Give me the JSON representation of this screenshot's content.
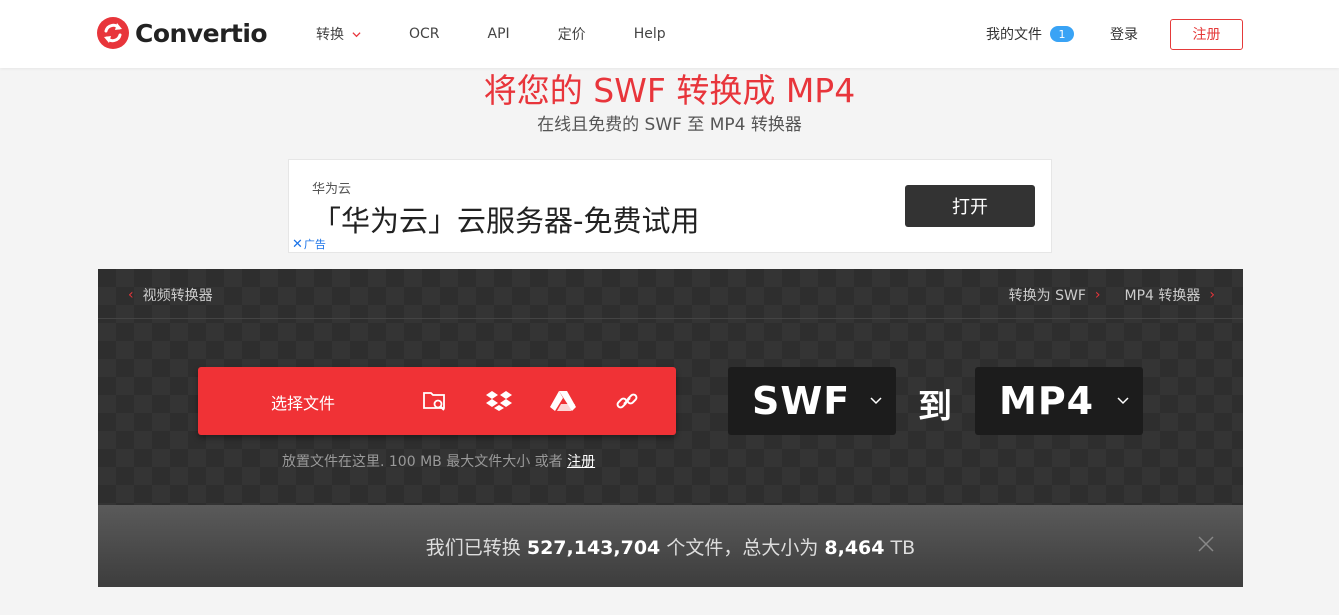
{
  "brand": {
    "name": "Convertio",
    "color": "#e8353b"
  },
  "nav": {
    "items": [
      {
        "label": "转换",
        "has_dropdown": true
      },
      {
        "label": "OCR"
      },
      {
        "label": "API"
      },
      {
        "label": "定价"
      },
      {
        "label": "Help"
      }
    ],
    "my_files": "我的文件",
    "file_count": "1",
    "login": "登录",
    "signup": "注册"
  },
  "hero": {
    "title": "将您的 SWF 转换成 MP4",
    "subtitle": "在线且免费的 SWF 至 MP4 转换器"
  },
  "ad": {
    "brand": "华为云",
    "headline": "「华为云」云服务器-免费试用",
    "cta": "打开",
    "ad_mark": "✕",
    "ad_label": "广告"
  },
  "converter": {
    "crumb_left": "视频转换器",
    "crumb_right": [
      "转换为 SWF",
      "MP4 转换器"
    ],
    "choose_label": "选择文件",
    "source_icons": [
      "folder-search-icon",
      "dropbox-icon",
      "google-drive-icon",
      "link-icon"
    ],
    "drop_hint": "放置文件在这里. 100 MB 最大文件大小 或者",
    "drop_hint_link": "注册",
    "from_format": "SWF",
    "to_label": "到",
    "to_format": "MP4"
  },
  "stats": {
    "prefix": "我们已转换",
    "files": "527,143,704",
    "middle": "个文件，总大小为",
    "size": "8,464",
    "unit": "TB"
  }
}
